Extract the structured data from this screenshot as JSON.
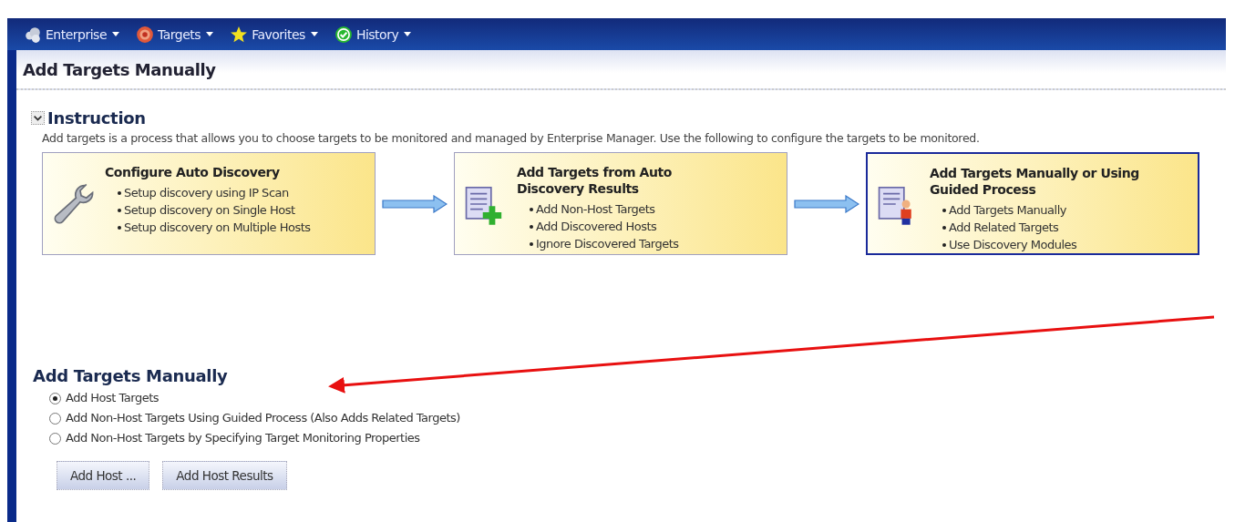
{
  "menu": [
    {
      "label": "Enterprise",
      "kind": "enterprise"
    },
    {
      "label": "Targets",
      "kind": "targets"
    },
    {
      "label": "Favorites",
      "kind": "favorites"
    },
    {
      "label": "History",
      "kind": "history"
    }
  ],
  "page_title": "Add Targets Manually",
  "instruction": {
    "heading": "Instruction",
    "expanded": true,
    "text": "Add targets is a process that allows you to choose targets to be monitored and managed by Enterprise Manager. Use the following to configure the targets to be monitored.",
    "cards": [
      {
        "kind": "wrench",
        "title": "Configure Auto Discovery",
        "selected": false,
        "items": [
          "Setup discovery using IP Scan",
          "Setup discovery on Single Host",
          "Setup discovery on Multiple Hosts"
        ]
      },
      {
        "kind": "add",
        "title": "Add Targets from Auto Discovery Results",
        "selected": false,
        "items": [
          "Add Non-Host Targets",
          "Add Discovered Hosts",
          "Ignore Discovered Targets"
        ]
      },
      {
        "kind": "person",
        "title": "Add Targets Manually or Using Guided Process",
        "selected": true,
        "items": [
          "Add Targets Manually",
          "Add Related Targets",
          "Use Discovery Modules"
        ]
      }
    ]
  },
  "section": {
    "heading": "Add Targets Manually",
    "options": [
      {
        "label": "Add Host Targets",
        "selected": true
      },
      {
        "label": "Add Non-Host Targets Using Guided Process (Also Adds Related Targets)",
        "selected": false
      },
      {
        "label": "Add Non-Host Targets by Specifying Target Monitoring Properties",
        "selected": false
      }
    ],
    "buttons": [
      "Add Host ...",
      "Add Host Results"
    ]
  }
}
